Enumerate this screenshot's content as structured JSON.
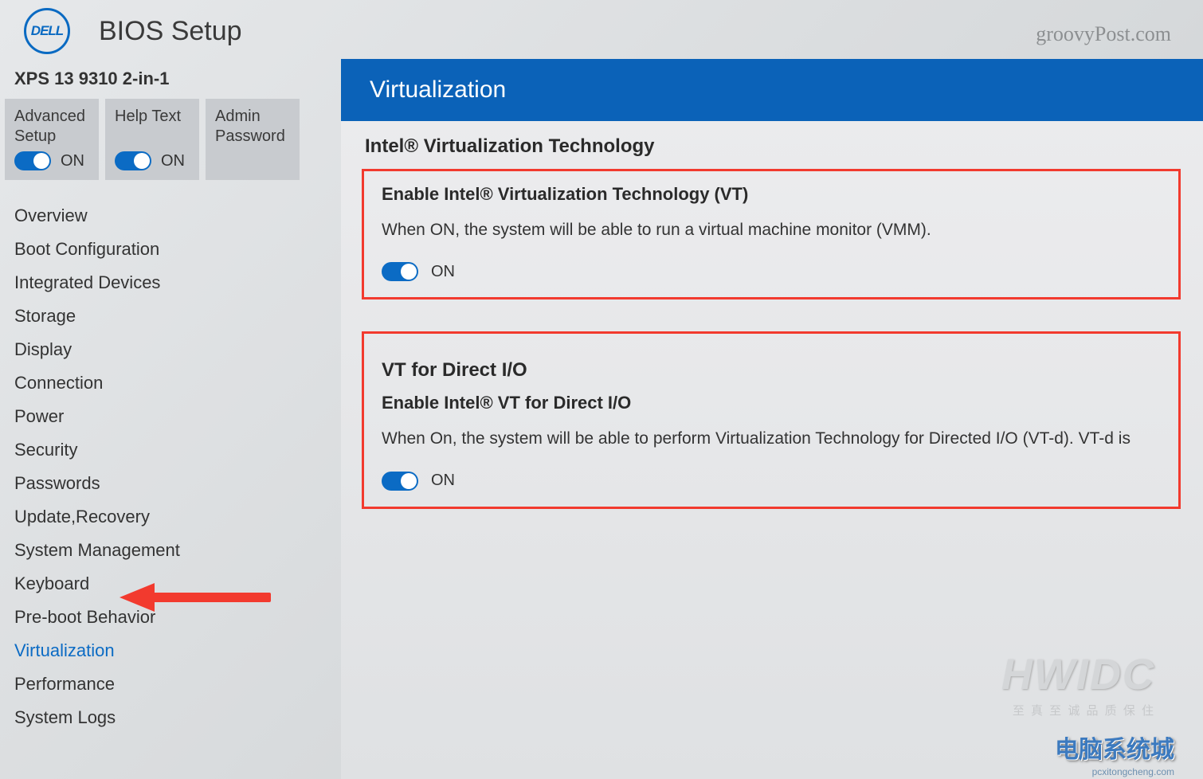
{
  "header": {
    "logo_text": "DELL",
    "title": "BIOS Setup",
    "top_watermark": "groovyPost.com"
  },
  "sidebar": {
    "model": "XPS 13 9310 2-in-1",
    "cards": [
      {
        "label": "Advanced\nSetup",
        "state": "ON"
      },
      {
        "label": "Help Text",
        "state": "ON"
      },
      {
        "label": "Admin\nPassword",
        "state": ""
      }
    ],
    "nav": [
      "Overview",
      "Boot Configuration",
      "Integrated Devices",
      "Storage",
      "Display",
      "Connection",
      "Power",
      "Security",
      "Passwords",
      "Update,Recovery",
      "System Management",
      "Keyboard",
      "Pre-boot Behavior",
      "Virtualization",
      "Performance",
      "System Logs"
    ],
    "active_index": 13
  },
  "main": {
    "page_title": "Virtualization",
    "section1": {
      "heading": "Intel® Virtualization Technology",
      "option_title": "Enable Intel® Virtualization Technology (VT)",
      "description": "When ON, the system will be able to run a virtual machine monitor (VMM).",
      "state": "ON"
    },
    "section2": {
      "heading": "VT for Direct I/O",
      "option_title": "Enable Intel® VT for Direct I/O",
      "description": "When On, the system will be able to perform Virtualization Technology for Directed I/O (VT-d). VT-d is",
      "state": "ON"
    }
  },
  "watermarks": {
    "w1": "HWIDC",
    "w2": "至 真 至 诚   品 质 保 住",
    "w3": "电脑系统城",
    "w4": "pcxitongcheng.com"
  }
}
